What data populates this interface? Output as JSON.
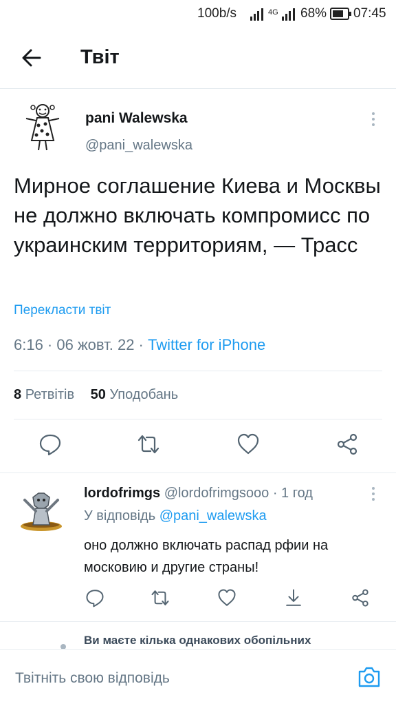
{
  "status_bar": {
    "speed": "100b/s",
    "network": "4G",
    "battery": "68%",
    "time": "07:45"
  },
  "header": {
    "title": "Твіт"
  },
  "tweet": {
    "author_name": "pani Walewska",
    "author_handle": "@pani_walewska",
    "text": "Мирное соглашение Киева и Москвы не должно включать компромисс по украинским территориям, — Трасс",
    "translate_label": "Перекласти твіт",
    "timestamp": "6:16 · 06 жовт. 22 · ",
    "source": "Twitter for iPhone",
    "retweets_count": "8",
    "retweets_label": "Ретвітів",
    "likes_count": "50",
    "likes_label": "Уподобань"
  },
  "reply": {
    "author_name": "lordofrimgs",
    "author_handle": "@lordofrimgsooo",
    "time": "· 1 год",
    "reply_to_label": "У відповідь",
    "reply_to_handle": "@pani_walewska",
    "text": "оно должно включать распад рфии на московию и другие страны!"
  },
  "suggestion": {
    "text": "Ви маєте кілька однакових обопільних"
  },
  "composer": {
    "placeholder": "Твітніть свою відповідь"
  },
  "colors": {
    "accent": "#1d9bf0",
    "secondary_text": "#657786",
    "divider": "#e6ecf0"
  }
}
